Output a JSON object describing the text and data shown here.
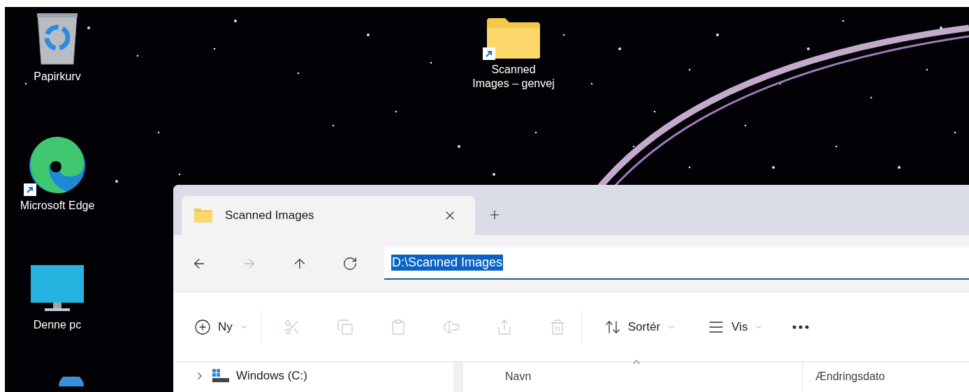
{
  "desktop": {
    "icons": [
      {
        "kind": "recycle-bin",
        "label": "Papirkurv",
        "shortcut": false
      },
      {
        "kind": "browser",
        "label": "Microsoft Edge",
        "shortcut": true
      },
      {
        "kind": "computer",
        "label": "Denne pc",
        "shortcut": false
      },
      {
        "kind": "globe",
        "shortcut": false
      }
    ],
    "shortcut_icon": {
      "kind": "folder",
      "label": "Scanned Images – genvej",
      "shortcut": true
    }
  },
  "explorer": {
    "tabs": [
      {
        "label": "Scanned Images",
        "selected": true
      }
    ],
    "nav": [
      {
        "kind": "back",
        "disabled": false
      },
      {
        "kind": "forward",
        "disabled": true
      },
      {
        "kind": "up",
        "disabled": false
      },
      {
        "kind": "refresh",
        "disabled": false
      }
    ],
    "address": {
      "value": "D:\\Scanned Images",
      "selected": true
    },
    "toolbar": [
      {
        "kind": "new",
        "label": "Ny",
        "dropdown": true,
        "disabled": false
      },
      {
        "kind": "cut",
        "disabled": true
      },
      {
        "kind": "copy",
        "disabled": true
      },
      {
        "kind": "paste",
        "disabled": true
      },
      {
        "kind": "rename",
        "disabled": true
      },
      {
        "kind": "share",
        "disabled": true
      },
      {
        "kind": "delete",
        "disabled": true
      },
      {
        "kind": "sort",
        "label": "Sortér",
        "dropdown": true,
        "disabled": false
      },
      {
        "kind": "view",
        "label": "Vis",
        "dropdown": true,
        "disabled": false
      },
      {
        "kind": "more",
        "disabled": false
      }
    ],
    "sidebar": {
      "items": [
        {
          "label": "Windows (C:)",
          "expanded": false
        }
      ]
    },
    "columns": [
      {
        "label": "Navn",
        "sorted": true
      },
      {
        "label": "Ændringsdato",
        "sorted": false
      }
    ]
  }
}
